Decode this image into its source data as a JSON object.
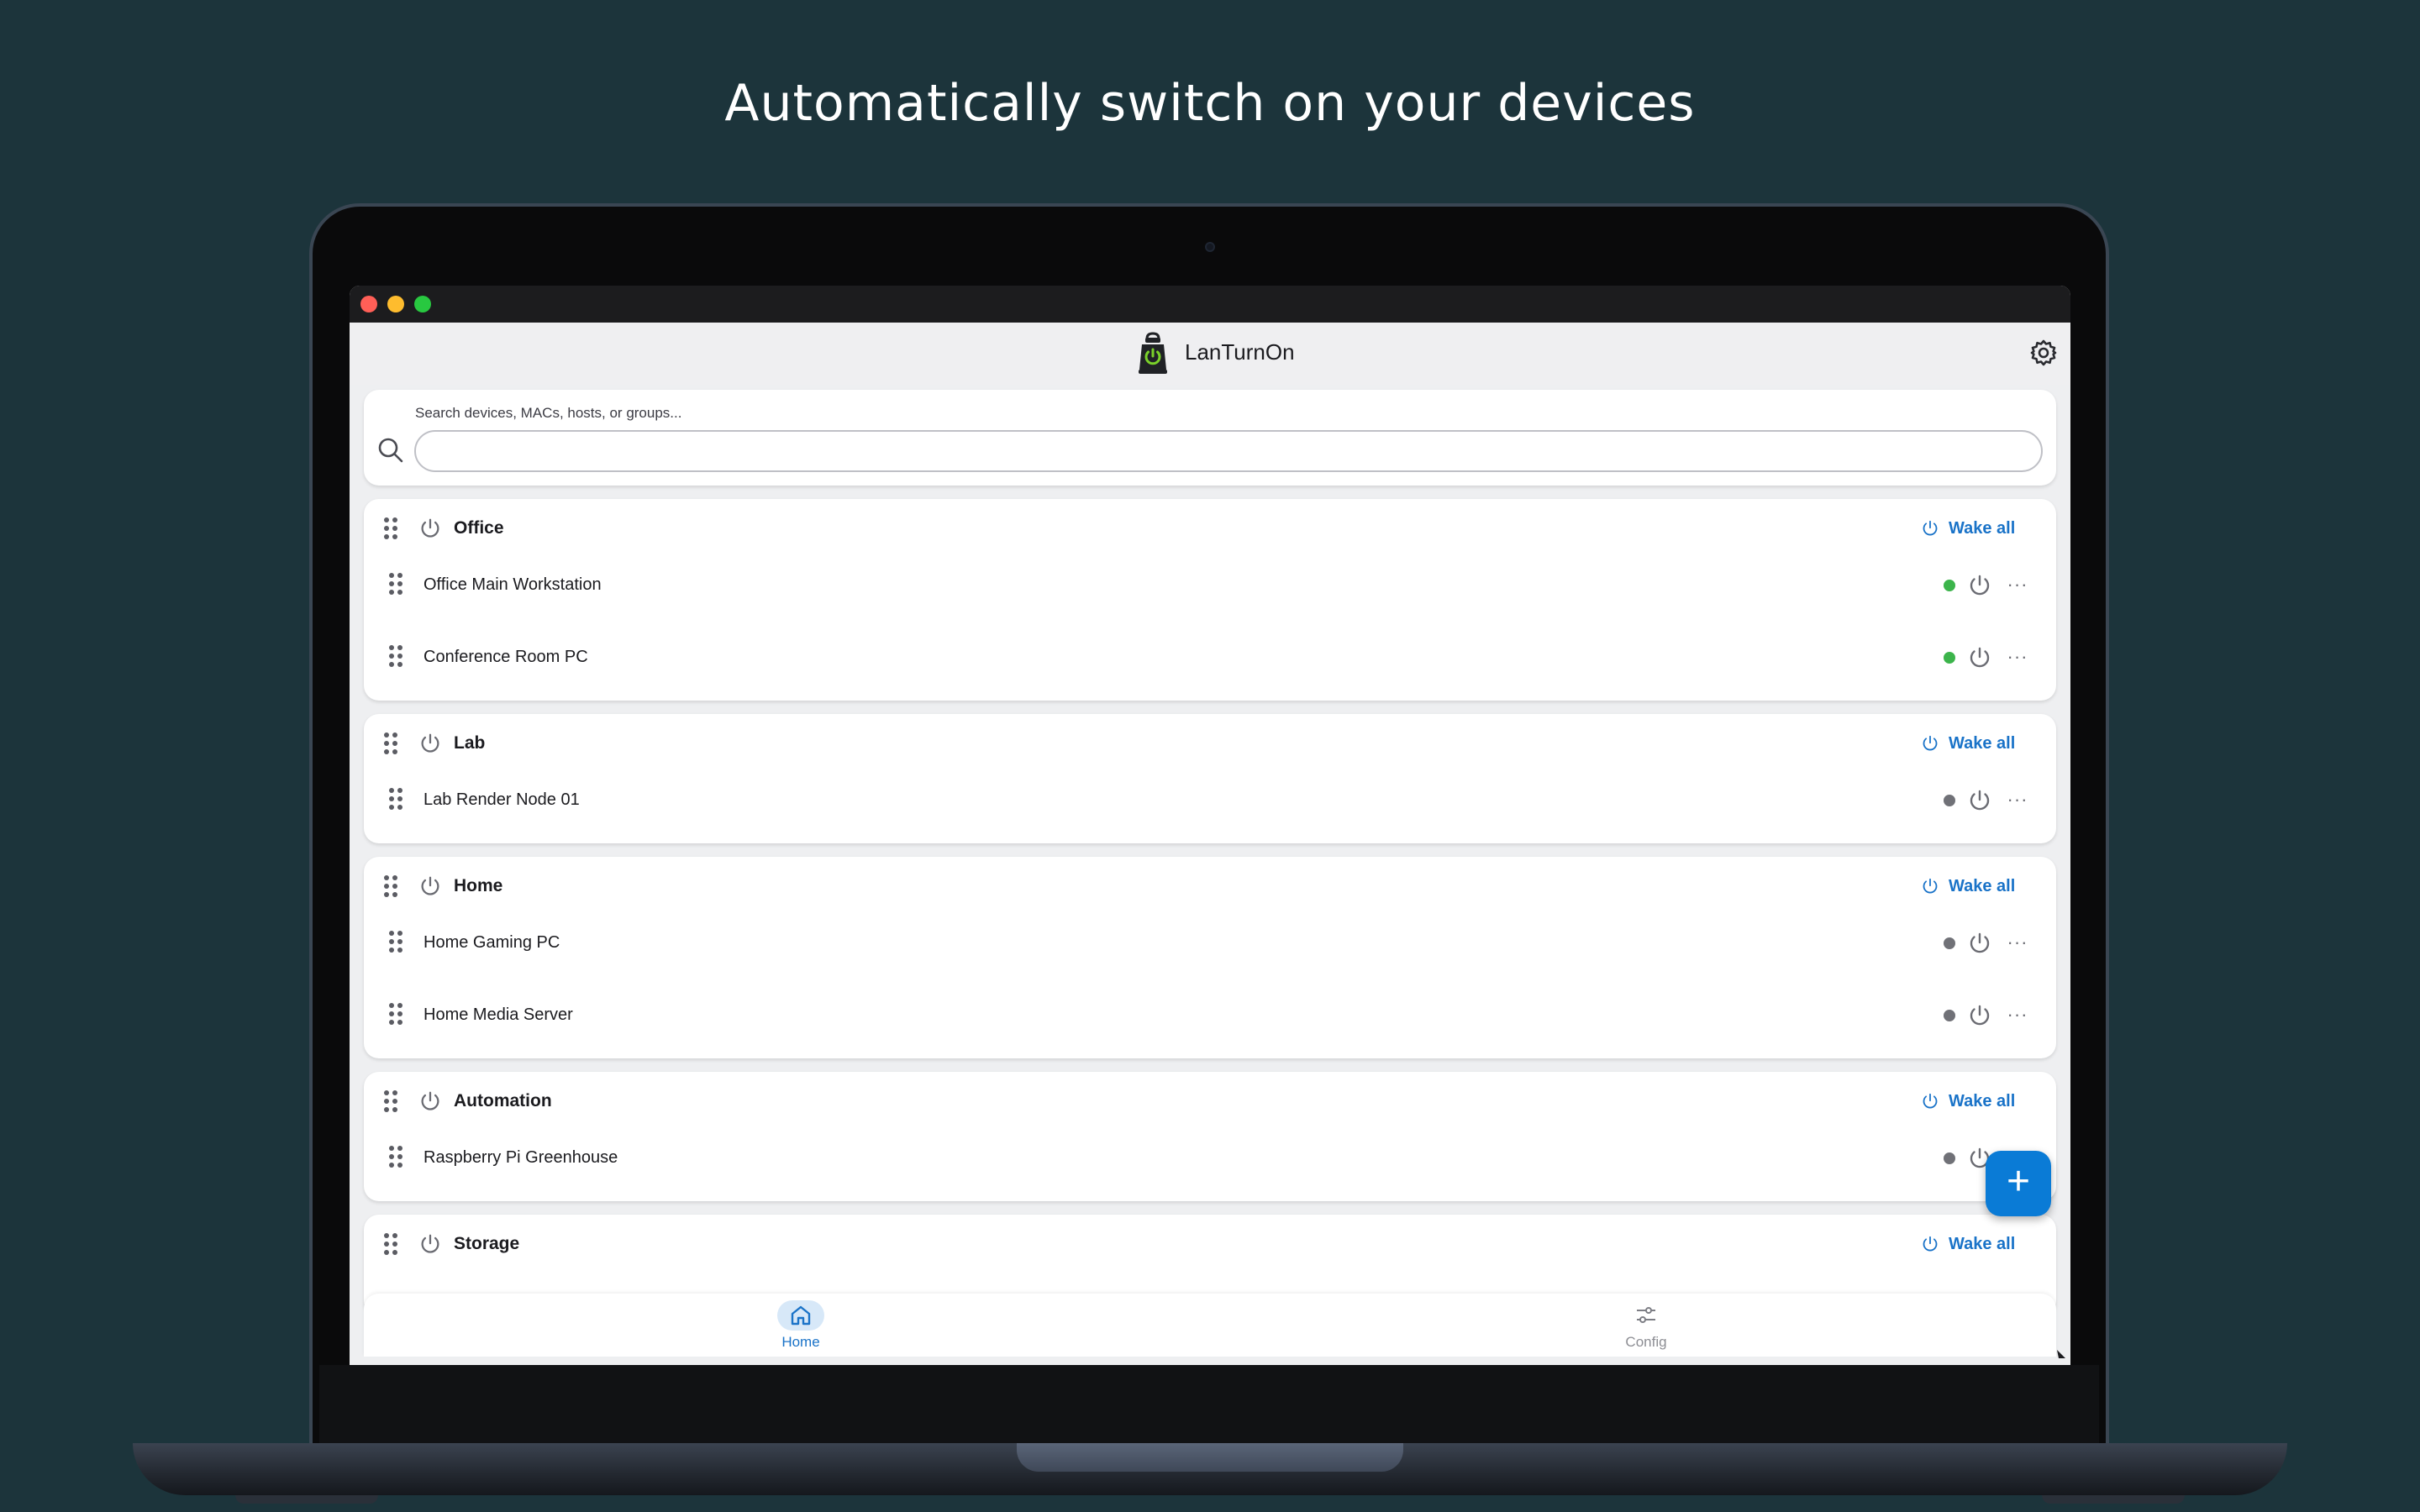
{
  "headline": "Automatically switch on your devices",
  "app": {
    "title": "LanTurnOn",
    "logo_icon": "lantern-power-icon",
    "settings_icon": "gear-icon"
  },
  "search": {
    "label": "Search devices, MACs, hosts, or groups...",
    "value": ""
  },
  "wake_all_label": "Wake all",
  "colors": {
    "accent": "#1a73c8",
    "fab": "#0a7bd6",
    "online": "#3cb44b",
    "offline": "#707177",
    "background": "#1c343b"
  },
  "groups": [
    {
      "name": "Office",
      "devices": [
        {
          "name": "Office Main Workstation",
          "status": "online"
        },
        {
          "name": "Conference Room PC",
          "status": "online"
        }
      ]
    },
    {
      "name": "Lab",
      "devices": [
        {
          "name": "Lab Render Node 01",
          "status": "offline"
        }
      ]
    },
    {
      "name": "Home",
      "devices": [
        {
          "name": "Home Gaming PC",
          "status": "offline"
        },
        {
          "name": "Home Media Server",
          "status": "offline"
        }
      ]
    },
    {
      "name": "Automation",
      "devices": [
        {
          "name": "Raspberry Pi Greenhouse",
          "status": "offline"
        }
      ]
    },
    {
      "name": "Storage",
      "devices": []
    }
  ],
  "fab": {
    "label": "+"
  },
  "nav": {
    "home_label": "Home",
    "config_label": "Config"
  }
}
